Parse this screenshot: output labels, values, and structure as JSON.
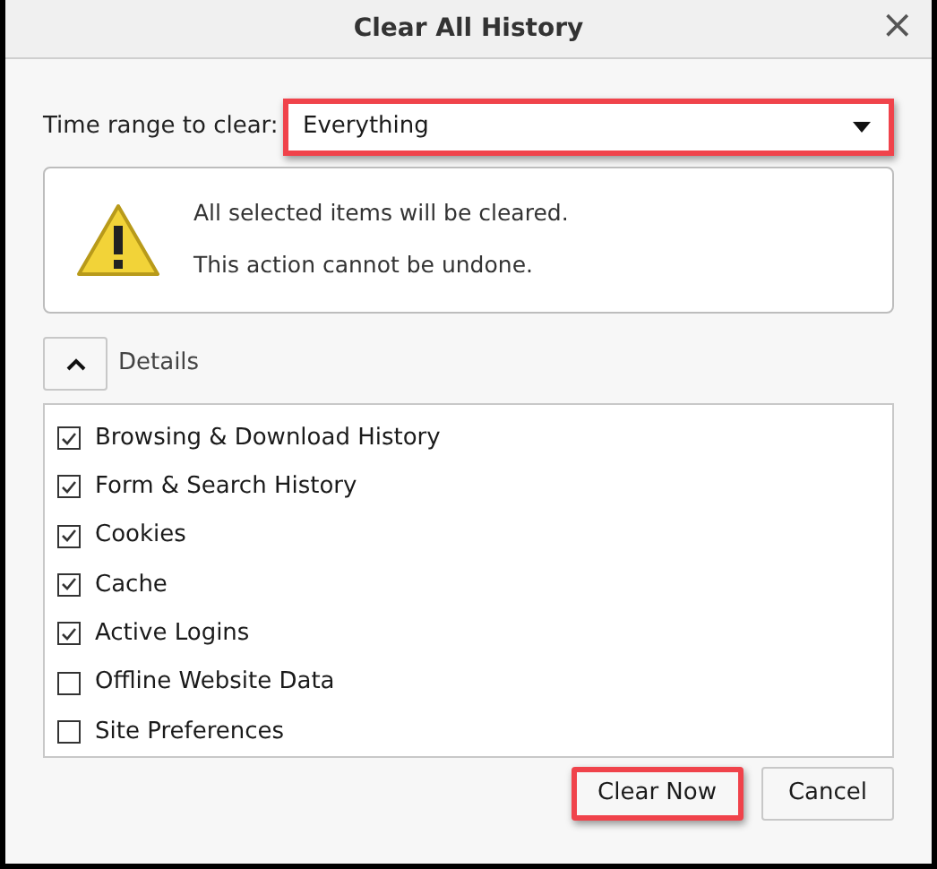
{
  "window": {
    "title": "Clear All History",
    "close": "×"
  },
  "time_range": {
    "label": "Time range to clear:",
    "value": "Everything",
    "highlighted": true
  },
  "warning": {
    "lines": [
      "All selected items will be cleared.",
      "This action cannot be undone."
    ]
  },
  "details": {
    "label": "Details",
    "expanded": true
  },
  "items": [
    {
      "label": "Browsing & Download History",
      "checked": true
    },
    {
      "label": "Form & Search History",
      "checked": true
    },
    {
      "label": "Cookies",
      "checked": true
    },
    {
      "label": "Cache",
      "checked": true
    },
    {
      "label": "Active Logins",
      "checked": true
    },
    {
      "label": "Offline Website Data",
      "checked": false
    },
    {
      "label": "Site Preferences",
      "checked": false
    }
  ],
  "buttons": [
    {
      "label": "Clear Now",
      "highlighted": true
    },
    {
      "label": "Cancel",
      "highlighted": false
    }
  ]
}
